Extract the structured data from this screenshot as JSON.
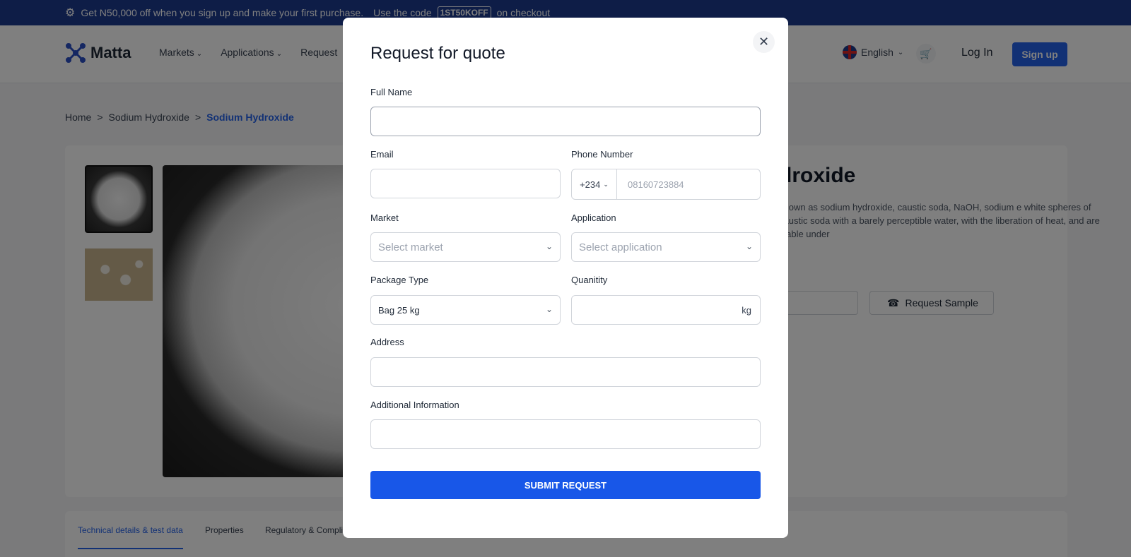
{
  "promo": {
    "text": "Get N50,000 off when you sign up and make your first purchase.",
    "code_prefix": "Use the code",
    "code": "1ST50KOFF",
    "code_suffix": "on checkout"
  },
  "header": {
    "logo": "Matta",
    "nav": [
      "Markets",
      "Applications",
      "Request"
    ],
    "language": "English",
    "login": "Log In",
    "signup": "Sign up"
  },
  "breadcrumb": [
    "Home",
    "Sodium Hydroxide",
    "Sodium Hydroxide"
  ],
  "product": {
    "title_partial": "droxide",
    "desc_partial": "known as sodium hydroxide, caustic soda, NaOH, sodium e white spheres of caustic soda with a barely perceptible water, with the liberation of heat, and are stable under",
    "request_sample": "Request Sample"
  },
  "tabs": [
    "Technical details & test data",
    "Properties",
    "Regulatory & Compli"
  ],
  "modal": {
    "title": "Request for quote",
    "full_name_label": "Full Name",
    "email_label": "Email",
    "phone_label": "Phone Number",
    "phone_code": "+234",
    "phone_placeholder": "08160723884",
    "market_label": "Market",
    "market_placeholder": "Select market",
    "application_label": "Application",
    "application_placeholder": "Select application",
    "package_label": "Package Type",
    "package_value": "Bag 25 kg",
    "quantity_label": "Quanitity",
    "quantity_unit": "kg",
    "address_label": "Address",
    "additional_label": "Additional Information",
    "submit": "SUBMIT REQUEST"
  },
  "colors": {
    "primary": "#1857e8",
    "banner": "#1d3b8f"
  }
}
